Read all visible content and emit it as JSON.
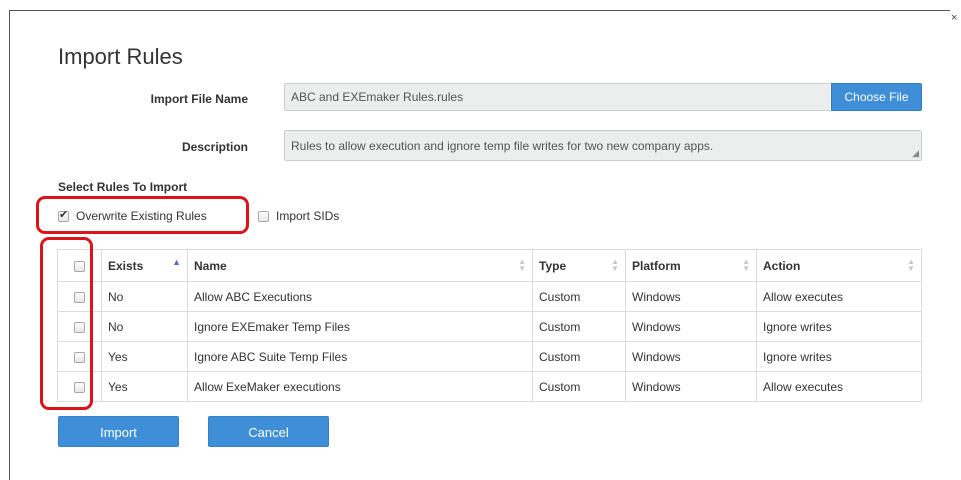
{
  "dialog": {
    "title": "Import Rules",
    "close_glyph": "×"
  },
  "form": {
    "file_label": "Import File Name",
    "file_value": "ABC and EXEmaker Rules.rules",
    "choose_label": "Choose File",
    "desc_label": "Description",
    "desc_value": "Rules to allow execution and ignore temp file writes for two new company apps."
  },
  "select_section": {
    "label": "Select Rules To Import",
    "overwrite_label": "Overwrite Existing Rules",
    "overwrite_checked": true,
    "import_sids_label": "Import SIDs",
    "import_sids_checked": false
  },
  "table": {
    "headers": [
      "Exists",
      "Name",
      "Type",
      "Platform",
      "Action"
    ],
    "rows": [
      {
        "exists": "No",
        "name": "Allow ABC Executions",
        "type": "Custom",
        "platform": "Windows",
        "action": "Allow executes"
      },
      {
        "exists": "No",
        "name": "Ignore EXEmaker Temp Files",
        "type": "Custom",
        "platform": "Windows",
        "action": "Ignore writes"
      },
      {
        "exists": "Yes",
        "name": "Ignore ABC Suite Temp Files",
        "type": "Custom",
        "platform": "Windows",
        "action": "Ignore writes"
      },
      {
        "exists": "Yes",
        "name": "Allow ExeMaker executions",
        "type": "Custom",
        "platform": "Windows",
        "action": "Allow executes"
      }
    ]
  },
  "buttons": {
    "import_label": "Import",
    "cancel_label": "Cancel"
  },
  "colors": {
    "accent": "#3e8ed8",
    "highlight": "#d9141b"
  }
}
